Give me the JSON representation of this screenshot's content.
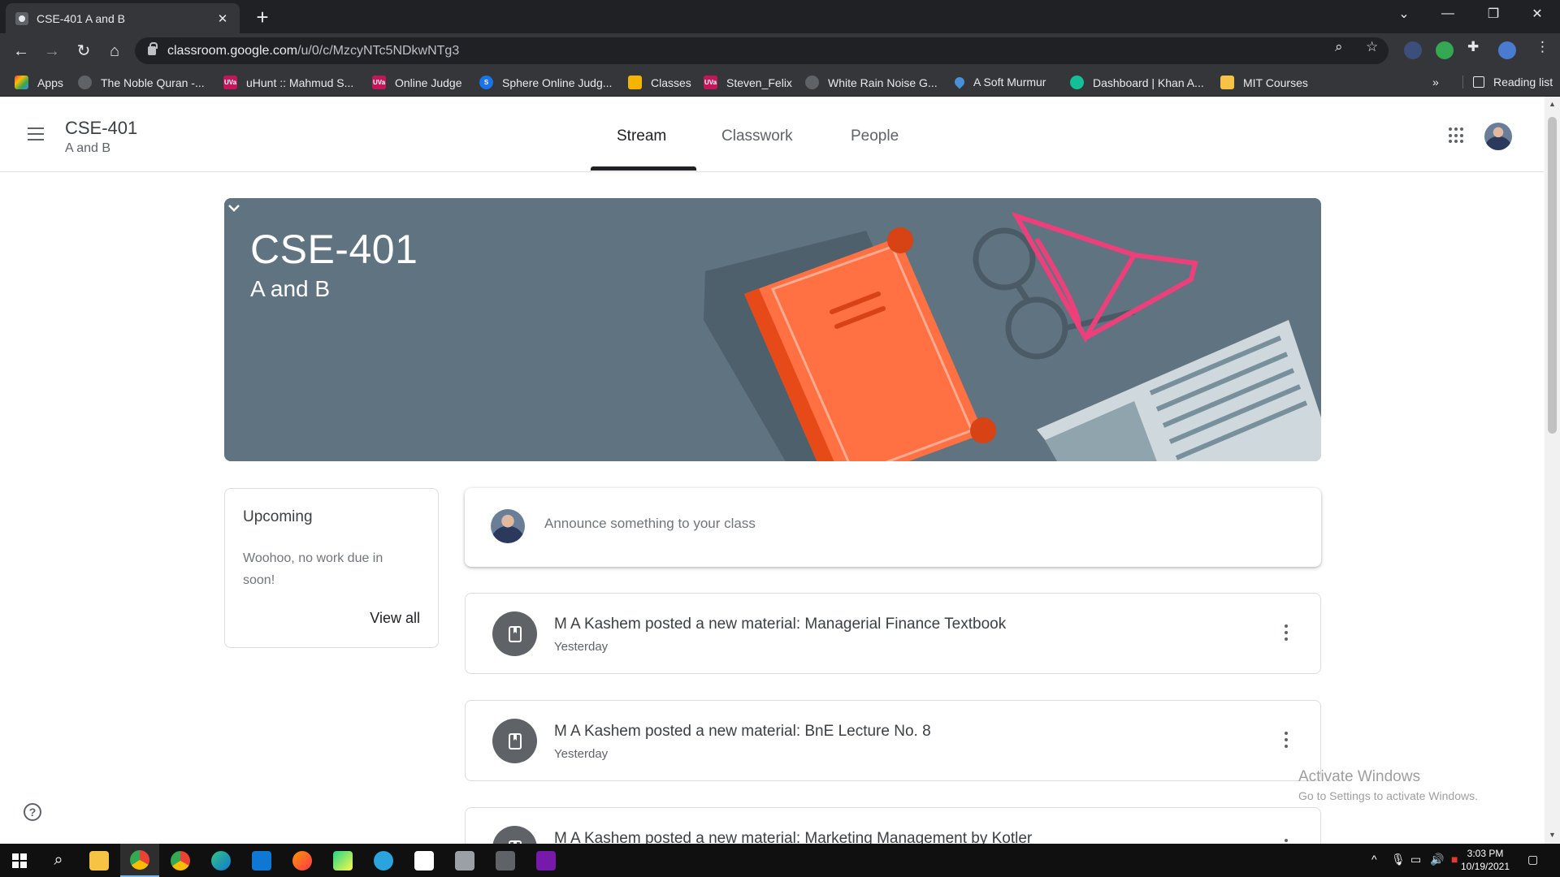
{
  "browser": {
    "tab_title": "CSE-401 A and B",
    "tab_close": "✕",
    "new_tab": "+",
    "url_host": "classroom.google.com",
    "url_path": "/u/0/c/MzcyNTc5NDkwNTg3",
    "window_controls": {
      "tab_search": "⌄",
      "minimize": "—",
      "restore": "❐",
      "close": "✕"
    }
  },
  "bookmarks": [
    {
      "label": "Apps",
      "icon": "apps-grid-icon",
      "color": "#ea4335"
    },
    {
      "label": "The Noble Quran -...",
      "icon": "quran-icon",
      "color": "#5f6368"
    },
    {
      "label": "uHunt :: Mahmud S...",
      "icon": "uva-icon",
      "color": "#c2185b"
    },
    {
      "label": "Online Judge",
      "icon": "uva-icon",
      "color": "#c2185b"
    },
    {
      "label": "Sphere Online Judg...",
      "icon": "spoj-icon",
      "color": "#1a73e8"
    },
    {
      "label": "Classes",
      "icon": "classroom-icon",
      "color": "#f4b400"
    },
    {
      "label": "Steven_Felix",
      "icon": "uva-icon",
      "color": "#c2185b"
    },
    {
      "label": "White Rain Noise G...",
      "icon": "noise-icon",
      "color": "#5f6368"
    },
    {
      "label": "A Soft Murmur",
      "icon": "droplet-icon",
      "color": "#4a90d9"
    },
    {
      "label": "Dashboard | Khan A...",
      "icon": "khan-icon",
      "color": "#14bf96"
    },
    {
      "label": "MIT Courses",
      "icon": "folder-icon",
      "color": "#f6c344"
    }
  ],
  "bookmarks_more": "»",
  "reading_list": "Reading list",
  "header": {
    "course": "CSE-401",
    "section": "A and B",
    "tabs": [
      "Stream",
      "Classwork",
      "People"
    ],
    "active_tab": "Stream"
  },
  "banner": {
    "title": "CSE-401",
    "subtitle": "A and B",
    "bg_color": "#5f7380"
  },
  "upcoming": {
    "title": "Upcoming",
    "message": "Woohoo, no work due in soon!",
    "view_all": "View all"
  },
  "announce": {
    "placeholder": "Announce something to your class"
  },
  "posts": [
    {
      "title": "M A Kashem posted a new material: Managerial Finance Textbook",
      "time": "Yesterday"
    },
    {
      "title": "M A Kashem posted a new material: BnE Lecture No. 8",
      "time": "Yesterday"
    },
    {
      "title": "M A Kashem posted a new material: Marketing Management by Kotler",
      "time": ""
    }
  ],
  "watermark": {
    "line1": "Activate Windows",
    "line2": "Go to Settings to activate Windows."
  },
  "taskbar": {
    "time": "3:03 PM",
    "date": "10/19/2021"
  },
  "colors": {
    "accent_dark": "#202124",
    "banner": "#5f7380",
    "book": "#ff7043"
  }
}
